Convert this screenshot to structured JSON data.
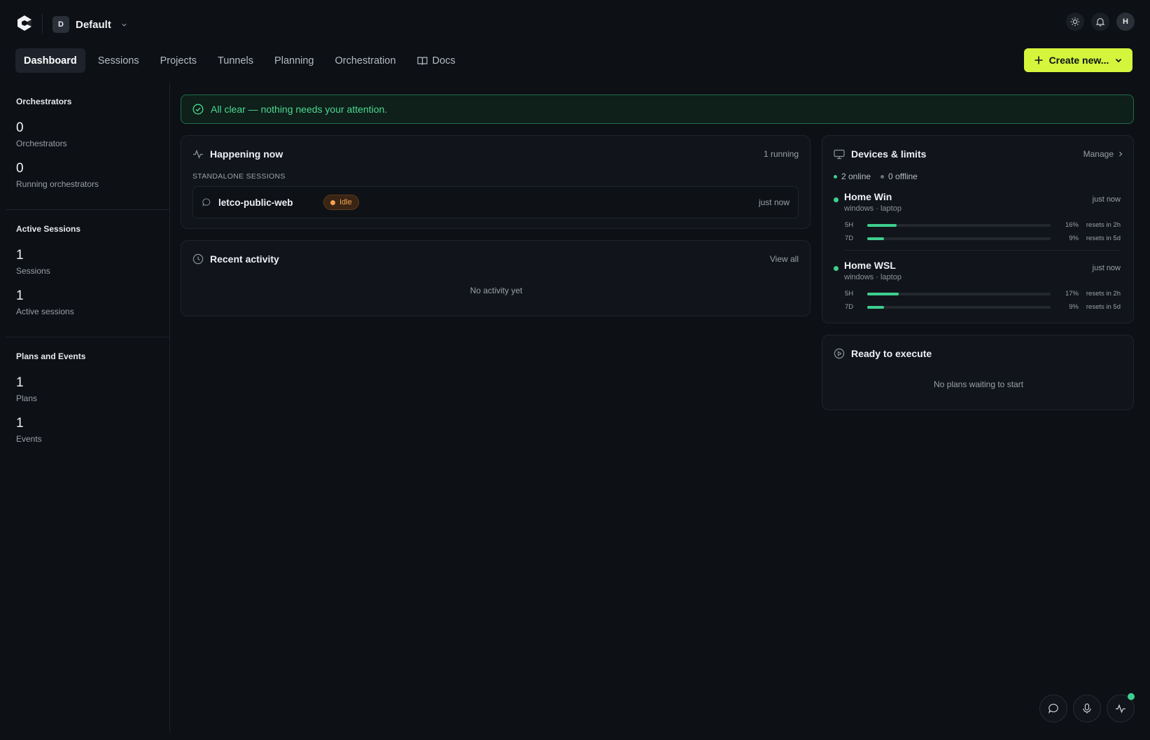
{
  "workspace": {
    "initial": "D",
    "name": "Default"
  },
  "user": {
    "initial": "H"
  },
  "nav": {
    "tabs": [
      {
        "label": "Dashboard"
      },
      {
        "label": "Sessions"
      },
      {
        "label": "Projects"
      },
      {
        "label": "Tunnels"
      },
      {
        "label": "Planning"
      },
      {
        "label": "Orchestration"
      },
      {
        "label": "Docs"
      }
    ],
    "create_label": "Create new..."
  },
  "sidebar": {
    "orchestrators": {
      "title": "Orchestrators",
      "stats": [
        {
          "value": "0",
          "label": "Orchestrators"
        },
        {
          "value": "0",
          "label": "Running orchestrators"
        }
      ]
    },
    "sessions": {
      "title": "Active Sessions",
      "stats": [
        {
          "value": "1",
          "label": "Sessions"
        },
        {
          "value": "1",
          "label": "Active sessions"
        }
      ]
    },
    "plans": {
      "title": "Plans and Events",
      "stats": [
        {
          "value": "1",
          "label": "Plans"
        },
        {
          "value": "1",
          "label": "Events"
        }
      ]
    }
  },
  "alert": {
    "text": "All clear — nothing needs your attention."
  },
  "happening": {
    "title": "Happening now",
    "count": "1 running",
    "section": "STANDALONE SESSIONS",
    "session": {
      "name": "letco-public-web",
      "status": "Idle",
      "time": "just now"
    }
  },
  "activity": {
    "title": "Recent activity",
    "view_all": "View all",
    "empty": "No activity yet"
  },
  "devices": {
    "title": "Devices & limits",
    "manage": "Manage",
    "online": "2 online",
    "offline": "0 offline",
    "items": [
      {
        "name": "Home Win",
        "sub": "windows · laptop",
        "time": "just now",
        "limits": [
          {
            "key": "5H",
            "pct": "16%",
            "reset": "resets in 2h",
            "fill": 0.16
          },
          {
            "key": "7D",
            "pct": "9%",
            "reset": "resets in 5d",
            "fill": 0.09
          }
        ]
      },
      {
        "name": "Home WSL",
        "sub": "windows · laptop",
        "time": "just now",
        "limits": [
          {
            "key": "5H",
            "pct": "17%",
            "reset": "resets in 2h",
            "fill": 0.17
          },
          {
            "key": "7D",
            "pct": "9%",
            "reset": "resets in 5d",
            "fill": 0.09
          }
        ]
      }
    ]
  },
  "ready": {
    "title": "Ready to execute",
    "empty": "No plans waiting to start"
  },
  "colors": {
    "accent": "#d4f53c",
    "success": "#3ecf8e",
    "idle": "#f2a450"
  }
}
